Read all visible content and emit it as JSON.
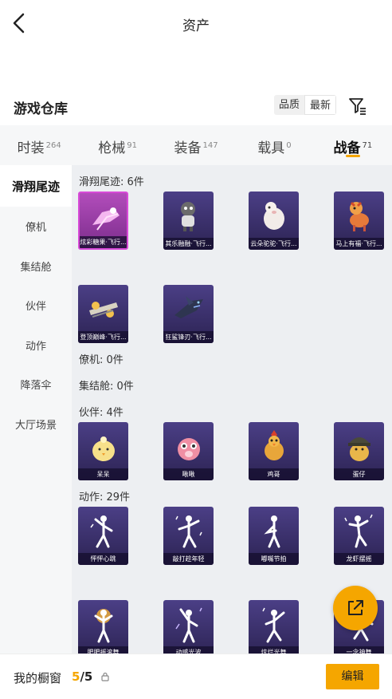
{
  "header": {
    "title": "资产"
  },
  "repo": {
    "title": "游戏仓库",
    "sort_options": [
      "品质",
      "最新"
    ],
    "active_sort": 1
  },
  "tabs": [
    {
      "label": "时装",
      "count": "264"
    },
    {
      "label": "枪械",
      "count": "91"
    },
    {
      "label": "装备",
      "count": "147"
    },
    {
      "label": "载具",
      "count": "0"
    },
    {
      "label": "战备",
      "count": "71"
    }
  ],
  "active_tab": 4,
  "sidebar": [
    "滑翔尾迹",
    "僚机",
    "集结舱",
    "伙伴",
    "动作",
    "降落伞",
    "大厅场景"
  ],
  "sections": {
    "trail": {
      "label": "滑翔尾迹: 6件",
      "items": [
        "炫彩糖果·飞行...",
        "其乐融融·飞行...",
        "云朵驼驼·飞行...",
        "马上有福·飞行...",
        "登顶巅峰·飞行...",
        "狂鲨锋刃·飞行..."
      ]
    },
    "wingman": {
      "label": "僚机: 0件"
    },
    "capsule": {
      "label": "集结舱: 0件"
    },
    "partner": {
      "label": "伙伴: 4件",
      "items": [
        "呆呆",
        "啾啾",
        "鸡哥",
        "蛋仔"
      ]
    },
    "emote": {
      "label": "动作: 29件",
      "items": [
        "怦怦心跳",
        "敲打趁年轻",
        "嘟嘴节拍",
        "龙虾摆摇",
        "肥肥摇滚舞",
        "动感光波",
        "炫烂光舞",
        "一念神舞"
      ]
    }
  },
  "bottom": {
    "showcase_label": "我的橱窗",
    "current": "5",
    "total": "/5",
    "edit_label": "编辑"
  },
  "colors": {
    "accent": "#f5a600",
    "card_bg": "#3d3470",
    "card_highlight": "#d84ad8"
  }
}
